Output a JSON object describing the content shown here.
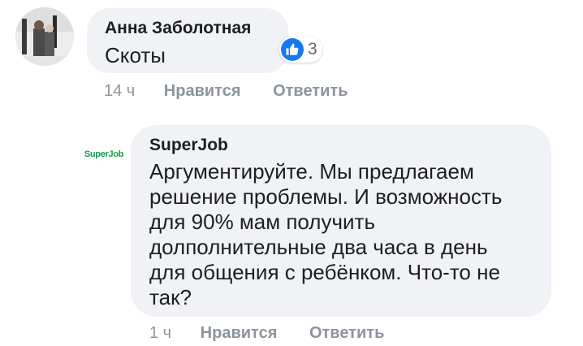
{
  "comments": [
    {
      "author": "Анна Заболотная",
      "text": "Скоты",
      "reaction_icon": "like-icon",
      "reaction_count": "3",
      "time": "14 ч",
      "like_label": "Нравится",
      "reply_label": "Ответить"
    },
    {
      "author": "SuperJob",
      "avatar_text": "SuperJob",
      "text": "Аргументируйте. Мы предлагаем\nрешение проблемы. И возможность\nдля 90% мам получить\nдолполнительные два часа в день\nдля общения с ребёнком. Что-то не\nтак?",
      "time": "1 ч",
      "like_label": "Нравится",
      "reply_label": "Ответить"
    }
  ],
  "colors": {
    "bubble": "#f1f2f6",
    "like_blue": "#1877f2",
    "meta_gray": "#8d949e",
    "brand_green": "#1a9a4a"
  }
}
